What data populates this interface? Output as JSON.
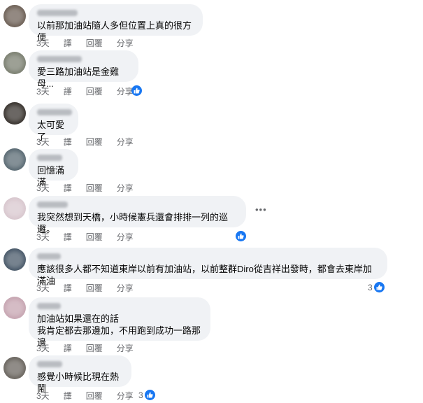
{
  "comments": [
    {
      "text": "以前那加油站隨人多但位置上真的很方便",
      "time": "3天",
      "translate": "譯",
      "reply": "回覆",
      "share": "分享"
    },
    {
      "text": "愛三路加油站是金雞母...",
      "time": "3天",
      "translate": "譯",
      "reply": "回覆",
      "share": "分享",
      "reaction": "like-icon"
    },
    {
      "text": "太可愛了",
      "time": "3天",
      "translate": "譯",
      "reply": "回覆",
      "share": "分享"
    },
    {
      "text": "回憶滿滿",
      "time": "3天",
      "translate": "譯",
      "reply": "回覆",
      "share": "分享"
    },
    {
      "text": "我突然想到天橋，小時候憲兵還會排排一列的巡邏。",
      "time": "3天",
      "translate": "譯",
      "reply": "回覆",
      "share": "分享",
      "reaction": "like-icon",
      "more": "•••"
    },
    {
      "text": "應該很多人都不知道東岸以前有加油站，以前整群Diro從吉祥出發時，都會去東岸加滿油",
      "time": "3天",
      "translate": "譯",
      "reply": "回覆",
      "share": "分享",
      "reaction_count": "3",
      "reaction": "like-icon"
    },
    {
      "text": "加油站如果還在的話\n我肯定都去那邊加，不用跑到成功一路那邊",
      "time": "3天",
      "translate": "譯",
      "reply": "回覆",
      "share": "分享"
    },
    {
      "text": "感覺小時候比現在熱鬧",
      "time": "3天",
      "translate": "譯",
      "reply": "回覆",
      "share": "分享",
      "reaction_count": "3",
      "reaction": "like-icon"
    }
  ],
  "colors": {
    "bubble": "#f0f2f5",
    "meta": "#65676b",
    "like": "#1877f2"
  }
}
